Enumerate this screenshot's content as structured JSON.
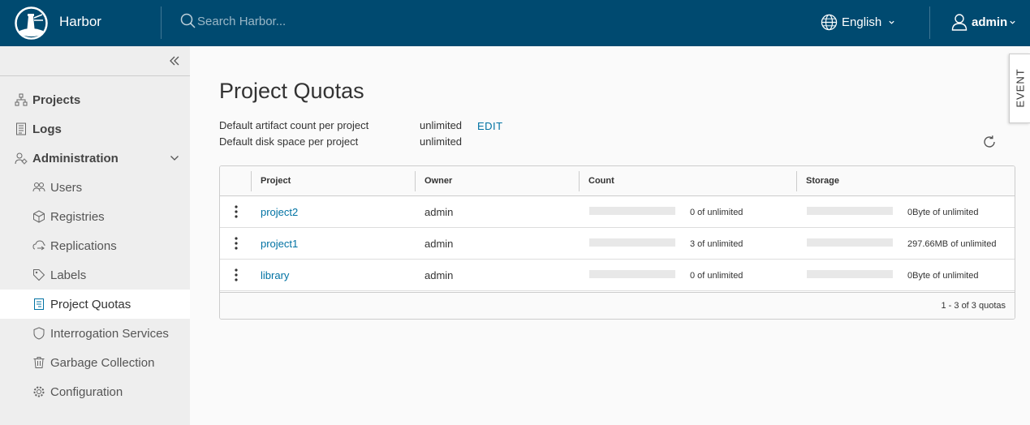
{
  "header": {
    "brand": "Harbor",
    "search_placeholder": "Search Harbor...",
    "language": "English",
    "user": "admin"
  },
  "sidebar": {
    "items": [
      {
        "label": "Projects",
        "icon": "projects-icon"
      },
      {
        "label": "Logs",
        "icon": "logs-icon"
      },
      {
        "label": "Administration",
        "icon": "administration-icon"
      }
    ],
    "admin_items": [
      {
        "label": "Users",
        "icon": "users-icon"
      },
      {
        "label": "Registries",
        "icon": "registries-icon"
      },
      {
        "label": "Replications",
        "icon": "replications-icon"
      },
      {
        "label": "Labels",
        "icon": "labels-icon"
      },
      {
        "label": "Project Quotas",
        "icon": "project-quotas-icon",
        "active": true
      },
      {
        "label": "Interrogation Services",
        "icon": "interrogation-icon"
      },
      {
        "label": "Garbage Collection",
        "icon": "trash-icon"
      },
      {
        "label": "Configuration",
        "icon": "gear-icon"
      }
    ]
  },
  "main": {
    "title": "Project Quotas",
    "defaults": [
      {
        "label": "Default artifact count per project",
        "value": "unlimited"
      },
      {
        "label": "Default disk space per project",
        "value": "unlimited"
      }
    ],
    "edit_label": "EDIT",
    "table": {
      "columns": [
        "Project",
        "Owner",
        "Count",
        "Storage"
      ],
      "rows": [
        {
          "project": "project2",
          "owner": "admin",
          "count_text": "0 of unlimited",
          "count_fraction": 0,
          "storage_text": "0Byte of unlimited",
          "storage_fraction": 0
        },
        {
          "project": "project1",
          "owner": "admin",
          "count_text": "3 of unlimited",
          "count_fraction": 0,
          "storage_text": "297.66MB of unlimited",
          "storage_fraction": 0
        },
        {
          "project": "library",
          "owner": "admin",
          "count_text": "0 of unlimited",
          "count_fraction": 0,
          "storage_text": "0Byte of unlimited",
          "storage_fraction": 0
        }
      ],
      "footer": "1 - 3 of 3 quotas"
    }
  },
  "event_tab": "EVENT",
  "colors": {
    "header_bg": "#004a70",
    "link": "#0072a3",
    "sidebar_bg": "#eeeeee",
    "active_item_bg": "#ffffff"
  }
}
